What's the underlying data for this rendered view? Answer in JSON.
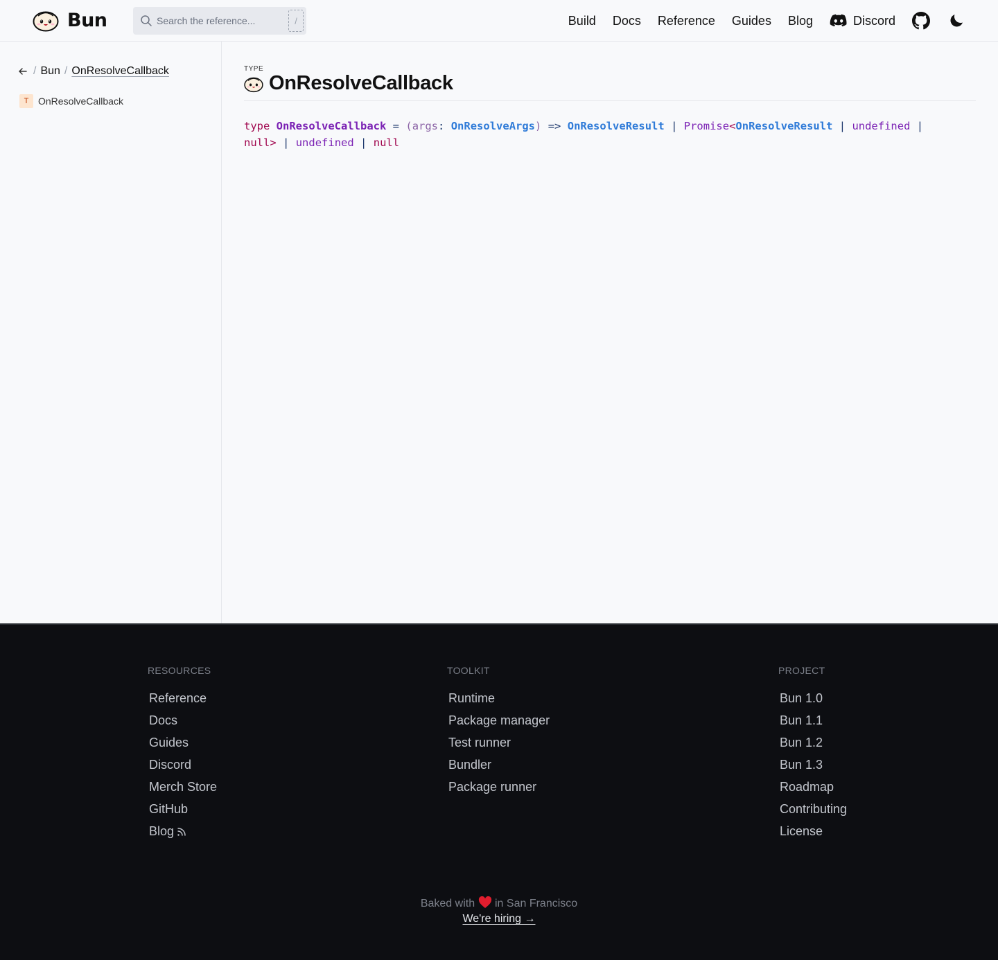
{
  "header": {
    "logo_text": "Bun",
    "search_placeholder": "Search the reference...",
    "search_shortcut": "/",
    "nav": [
      {
        "label": "Build"
      },
      {
        "label": "Docs"
      },
      {
        "label": "Reference"
      },
      {
        "label": "Guides"
      },
      {
        "label": "Blog"
      },
      {
        "label": "Discord",
        "icon": "discord-icon"
      }
    ],
    "github_icon": "github-icon",
    "theme_icon": "moon-icon"
  },
  "sidebar": {
    "breadcrumb": {
      "sep": "/",
      "root": "Bun",
      "current": "OnResolveCallback"
    },
    "items": [
      {
        "badge": "T",
        "label": "OnResolveCallback"
      }
    ]
  },
  "main": {
    "kind": "TYPE",
    "title": "OnResolveCallback",
    "code": {
      "kw_type": "type",
      "name": "OnResolveCallback",
      "eq": "=",
      "paren_open": "(",
      "arg": "args",
      "colon": ":",
      "arg_type": "OnResolveArgs",
      "paren_close": ")",
      "arrow": "=>",
      "ret1": "OnResolveResult",
      "pipe": "|",
      "promise": "Promise",
      "lt": "<",
      "ret2": "OnResolveResult",
      "undef": "undefined",
      "null": "null",
      "gt": ">"
    }
  },
  "footer": {
    "columns": [
      {
        "heading": "RESOURCES",
        "links": [
          "Reference",
          "Docs",
          "Guides",
          "Discord",
          "Merch Store",
          "GitHub",
          "Blog"
        ]
      },
      {
        "heading": "TOOLKIT",
        "links": [
          "Runtime",
          "Package manager",
          "Test runner",
          "Bundler",
          "Package runner"
        ]
      },
      {
        "heading": "PROJECT",
        "links": [
          "Bun 1.0",
          "Bun 1.1",
          "Bun 1.2",
          "Bun 1.3",
          "Roadmap",
          "Contributing",
          "License"
        ]
      }
    ],
    "baked_prefix": "Baked with",
    "baked_suffix": "in San Francisco",
    "hiring": "We're hiring →"
  },
  "colors": {
    "keyword": "#a1084f",
    "type_name": "#7b22b4",
    "type_ref": "#2f7bd8",
    "footer_bg": "#0d0e12",
    "heart": "#e11d2e"
  }
}
